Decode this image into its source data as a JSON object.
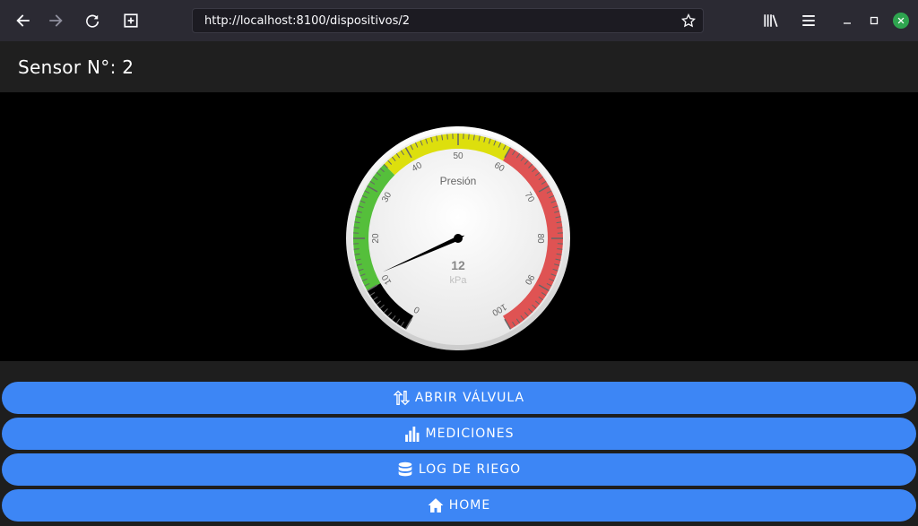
{
  "browser": {
    "url": "http://localhost:8100/dispositivos/2",
    "back_icon": "arrow-left-icon",
    "forward_icon": "arrow-right-icon",
    "reload_icon": "reload-icon",
    "newtab_icon": "new-tab-icon",
    "bookmark_icon": "star-icon",
    "library_icon": "library-icon",
    "menu_icon": "hamburger-icon"
  },
  "header": {
    "title": "Sensor N°: 2"
  },
  "gauge": {
    "title": "Presión",
    "value": 12,
    "value_label": "12",
    "unit": "kPa",
    "min": 0,
    "max": 100,
    "tick_labels": [
      "0",
      "10",
      "20",
      "30",
      "40",
      "50",
      "60",
      "70",
      "80",
      "90",
      "100"
    ],
    "bands": [
      {
        "from": 0,
        "to": 10,
        "color": "#000000"
      },
      {
        "from": 10,
        "to": 35,
        "color": "#55bf3b"
      },
      {
        "from": 35,
        "to": 60,
        "color": "#dddf0d"
      },
      {
        "from": 60,
        "to": 100,
        "color": "#df5353"
      }
    ]
  },
  "actions": [
    {
      "label": "ABRIR VÁLVULA",
      "icon": "swap-vertical-icon"
    },
    {
      "label": "MEDICIONES",
      "icon": "bar-chart-icon"
    },
    {
      "label": "LOG DE RIEGO",
      "icon": "database-icon"
    },
    {
      "label": "HOME",
      "icon": "home-icon"
    }
  ]
}
